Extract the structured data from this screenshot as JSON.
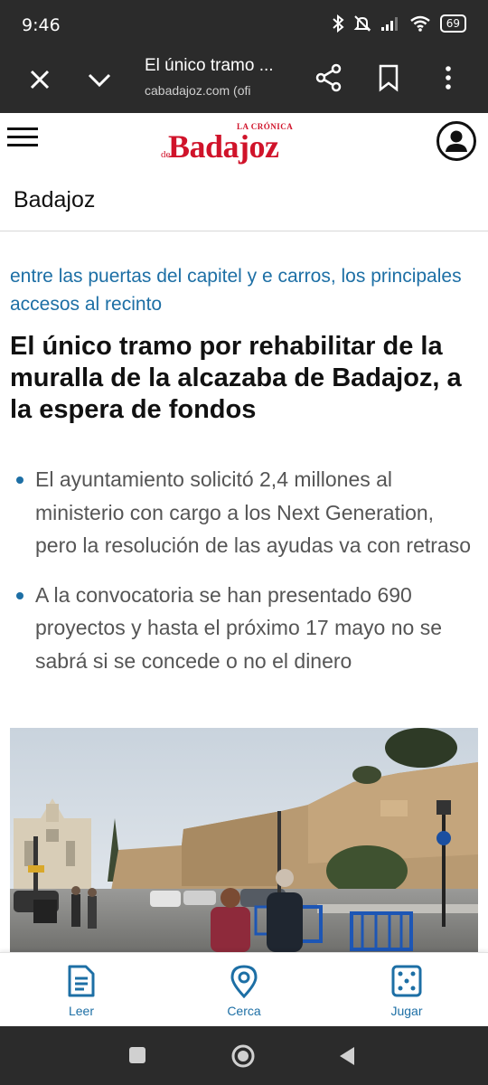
{
  "status": {
    "time": "9:46",
    "battery": "69"
  },
  "browser": {
    "tab_title": "El único tramo ...",
    "url": "cabadajoz.com (ofi"
  },
  "site": {
    "logo_small": "LA CRÓNICA",
    "logo_de": "de",
    "logo_main": "Badajoz"
  },
  "section": {
    "label": "Badajoz"
  },
  "article": {
    "kicker": "entre las puertas del capitel y e carros, los principales accesos al recinto",
    "headline": "El único tramo por rehabilitar de la muralla de la alcazaba de Badajoz, a la espera de fondos",
    "bullets": [
      "El ayuntamiento solicitó 2,4 millones al ministerio con cargo a los Next Generation, pero la resolución de las ayudas va con retraso",
      "A la convocatoria se han presentado 690 proyectos y hasta el próximo 17 mayo no se sabrá si se concede o no el dinero"
    ]
  },
  "bottom_nav": {
    "items": [
      {
        "label": "Leer",
        "icon": "document-icon"
      },
      {
        "label": "Cerca",
        "icon": "location-pin-icon"
      },
      {
        "label": "Jugar",
        "icon": "dice-icon"
      }
    ]
  },
  "colors": {
    "accent": "#1d6fa5",
    "brand_red": "#d0132a",
    "bar_dark": "#2b2b2b"
  }
}
